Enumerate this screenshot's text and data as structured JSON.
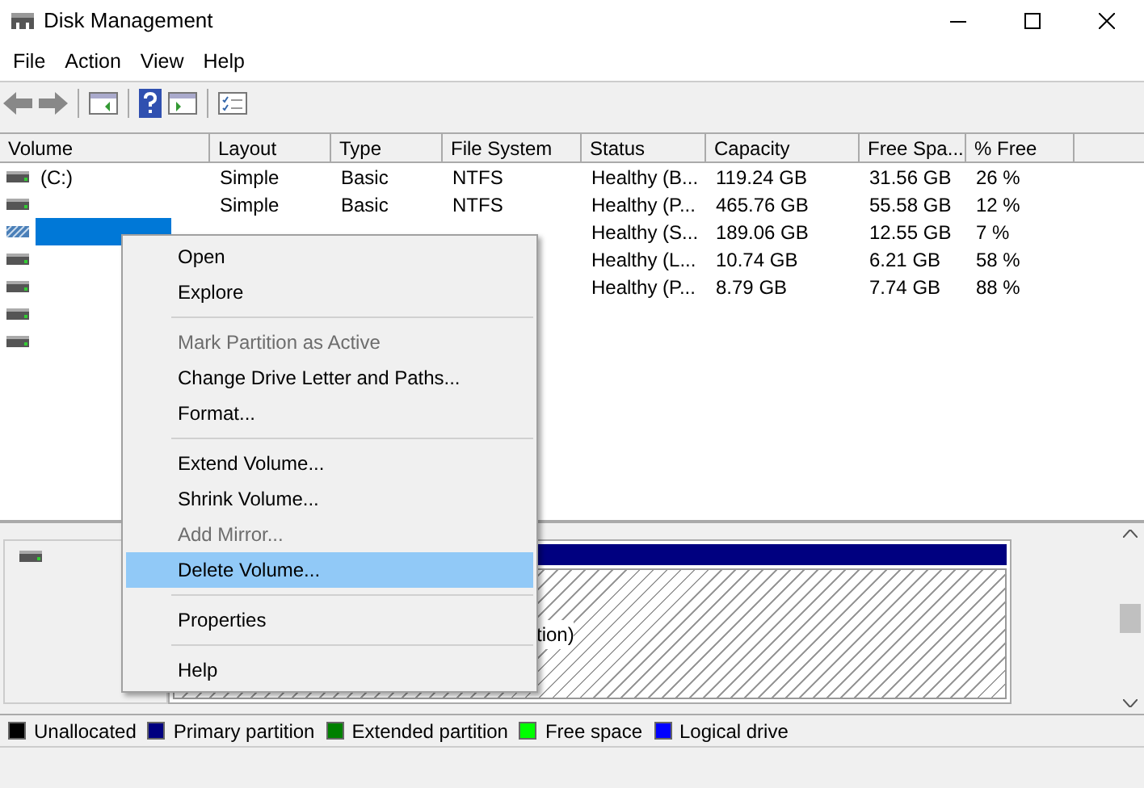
{
  "window": {
    "title": "Disk Management"
  },
  "menu_bar": [
    "File",
    "Action",
    "View",
    "Help"
  ],
  "table": {
    "columns": [
      "Volume",
      "Layout",
      "Type",
      "File System",
      "Status",
      "Capacity",
      "Free Spa...",
      "% Free"
    ],
    "rows": [
      {
        "selected": false,
        "cells": [
          "(C:)",
          "Simple",
          "Basic",
          "NTFS",
          "Healthy (B...",
          "119.24 GB",
          "31.56 GB",
          "26 %"
        ]
      },
      {
        "selected": false,
        "cells": [
          "",
          "Simple",
          "Basic",
          "NTFS",
          "Healthy (P...",
          "465.76 GB",
          "55.58 GB",
          "12 %"
        ]
      },
      {
        "selected": true,
        "cells": [
          "",
          "",
          "",
          "",
          "Healthy (S...",
          "189.06 GB",
          "12.55 GB",
          "7 %"
        ]
      },
      {
        "selected": false,
        "cells": [
          "",
          "",
          "",
          "",
          "Healthy (L...",
          "10.74 GB",
          "6.21 GB",
          "58 %"
        ]
      },
      {
        "selected": false,
        "cells": [
          "",
          "",
          "",
          "",
          "Healthy (P...",
          "8.79 GB",
          "7.74 GB",
          "88 %"
        ]
      },
      {
        "selected": false,
        "cells": [
          "",
          "",
          "",
          "",
          "",
          "",
          "",
          ""
        ]
      },
      {
        "selected": false,
        "cells": [
          "",
          "",
          "",
          "",
          "",
          "",
          "",
          ""
        ]
      }
    ]
  },
  "disk_pane": {
    "partition_label": "tion)"
  },
  "context_menu": [
    {
      "kind": "item",
      "label": "Open",
      "disabled": false,
      "selected": false
    },
    {
      "kind": "item",
      "label": "Explore",
      "disabled": false,
      "selected": false
    },
    {
      "kind": "separator"
    },
    {
      "kind": "item",
      "label": "Mark Partition as Active",
      "disabled": true,
      "selected": false
    },
    {
      "kind": "item",
      "label": "Change Drive Letter and Paths...",
      "disabled": false,
      "selected": false
    },
    {
      "kind": "item",
      "label": "Format...",
      "disabled": false,
      "selected": false
    },
    {
      "kind": "separator"
    },
    {
      "kind": "item",
      "label": "Extend Volume...",
      "disabled": false,
      "selected": false
    },
    {
      "kind": "item",
      "label": "Shrink Volume...",
      "disabled": false,
      "selected": false
    },
    {
      "kind": "item",
      "label": "Add Mirror...",
      "disabled": true,
      "selected": false
    },
    {
      "kind": "item",
      "label": "Delete Volume...",
      "disabled": false,
      "selected": true
    },
    {
      "kind": "separator"
    },
    {
      "kind": "item",
      "label": "Properties",
      "disabled": false,
      "selected": false
    },
    {
      "kind": "separator"
    },
    {
      "kind": "item",
      "label": "Help",
      "disabled": false,
      "selected": false
    }
  ],
  "legend": [
    {
      "label": "Unallocated",
      "color": "#000000"
    },
    {
      "label": "Primary partition",
      "color": "#000080"
    },
    {
      "label": "Extended partition",
      "color": "#008000"
    },
    {
      "label": "Free space",
      "color": "#00ff00"
    },
    {
      "label": "Logical drive",
      "color": "#0000ff"
    }
  ]
}
